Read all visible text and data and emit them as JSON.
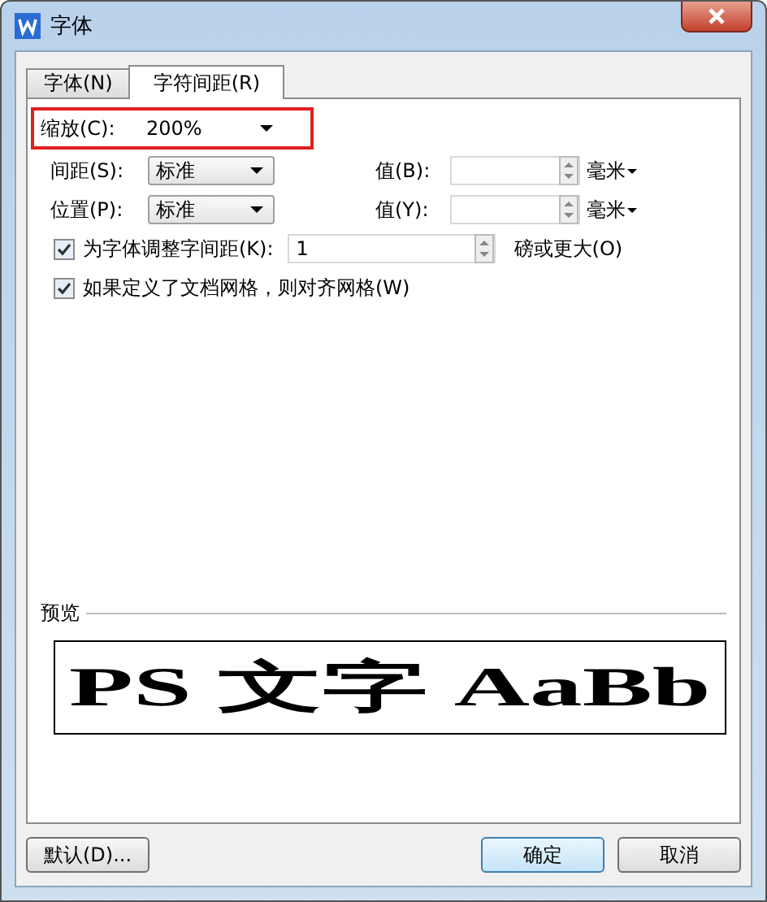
{
  "window": {
    "title": "字体"
  },
  "tabs": [
    {
      "label": "字体(N)",
      "selected": false
    },
    {
      "label": "字符间距(R)",
      "selected": true
    }
  ],
  "scale": {
    "label": "缩放(C):",
    "value": "200%",
    "highlighted": true
  },
  "spacing": {
    "label": "间距(S):",
    "value": "标准",
    "value_label": "值(B):",
    "unit": "毫米"
  },
  "position": {
    "label": "位置(P):",
    "value": "标准",
    "value_label": "值(Y):",
    "unit": "毫米"
  },
  "kerning": {
    "label": "为字体调整字间距(K):",
    "checked": true,
    "value": "1",
    "suffix": "磅或更大(O)"
  },
  "grid": {
    "label": "如果定义了文档网格，则对齐网格(W)",
    "checked": true
  },
  "preview": {
    "title": "预览",
    "sample": "PS 文字 AaBb"
  },
  "buttons": [
    {
      "label": "默认(D)...",
      "default": false
    },
    {
      "label": "确定",
      "default": true
    },
    {
      "label": "取消",
      "default": false
    }
  ]
}
